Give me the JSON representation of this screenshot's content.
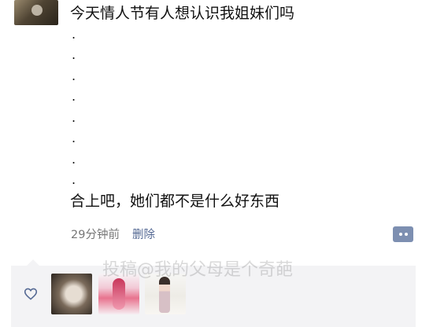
{
  "post": {
    "lines": [
      "今天情人节有人想认识我姐妹们吗",
      ".",
      ".",
      ".",
      ".",
      ".",
      ".",
      ".",
      ".",
      "合上吧，她们都不是什么好东西"
    ],
    "time": "29分钟前",
    "delete_label": "删除"
  },
  "watermark": "投稿@我的父母是个奇葩",
  "colors": {
    "link": "#576b95",
    "likes_bg": "#f3f3f5",
    "more_button": "#7d8fb1"
  },
  "icons": {
    "heart": "heart-icon",
    "more": "more-icon"
  }
}
